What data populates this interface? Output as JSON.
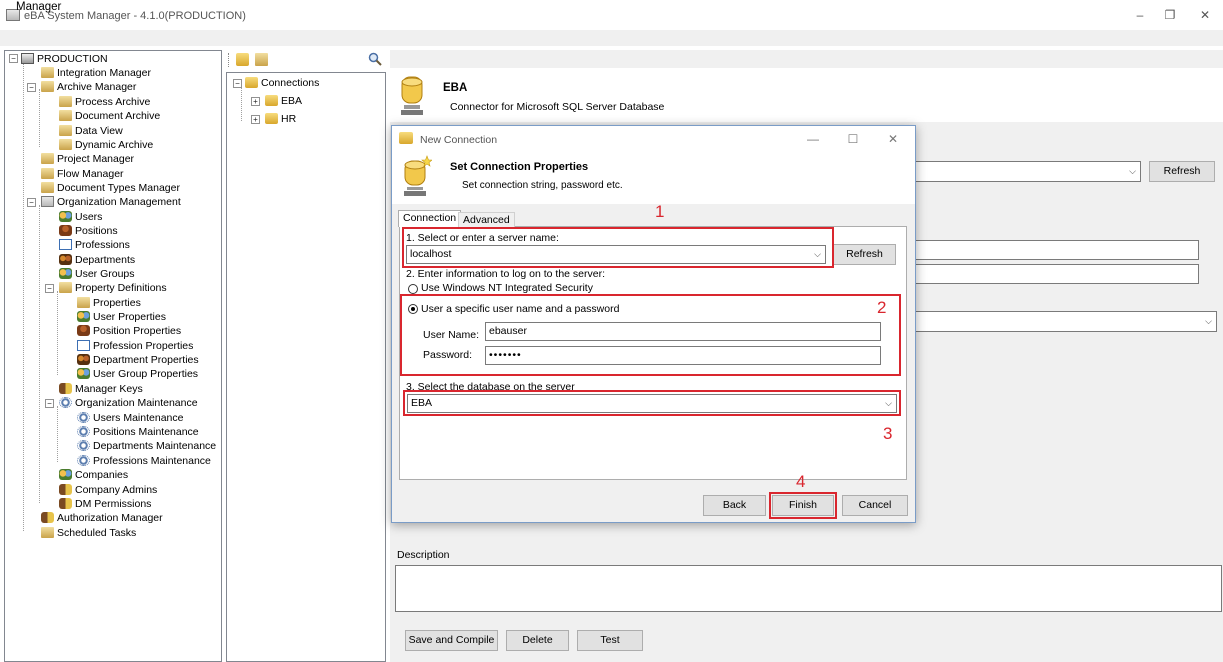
{
  "window": {
    "title": "eBA System Manager - 4.1.0(PRODUCTION)",
    "minimize": "–",
    "maximize": "❐",
    "close": "✕"
  },
  "menu": {
    "manager": "Manager"
  },
  "tree": {
    "root": "PRODUCTION",
    "items": [
      "Integration Manager",
      "Archive Manager",
      "Process Archive",
      "Document Archive",
      "Data View",
      "Dynamic Archive",
      "Project Manager",
      "Flow Manager",
      "Document Types Manager",
      "Organization Management",
      "Users",
      "Positions",
      "Professions",
      "Departments",
      "User Groups",
      "Property Definitions",
      "Properties",
      "User Properties",
      "Position Properties",
      "Profession Properties",
      "Department Properties",
      "User Group Properties",
      "Manager Keys",
      "Organization Maintenance",
      "Users Maintenance",
      "Positions Maintenance",
      "Departments Maintenance",
      "Professions Maintenance",
      "Companies",
      "Company Admins",
      "DM Permissions",
      "Authorization Manager",
      "Scheduled Tasks"
    ]
  },
  "connections": {
    "root": "Connections",
    "items": [
      "EBA",
      "HR"
    ]
  },
  "header": {
    "title": "EBA",
    "subtitle": "Connector for Microsoft SQL Server Database"
  },
  "right": {
    "refresh": "Refresh",
    "description_label": "Description",
    "buttons": {
      "save": "Save and Compile",
      "delete": "Delete",
      "test": "Test"
    }
  },
  "dialog": {
    "title": "New Connection",
    "head_title": "Set Connection Properties",
    "head_sub": "Set connection string, password etc.",
    "tabs": {
      "connection": "Connection",
      "advanced": "Advanced"
    },
    "step1_label": "1. Select or enter a server name:",
    "server_value": "localhost",
    "refresh": "Refresh",
    "step2_label": "2. Enter information to log on to the server:",
    "radio_windows": "Use Windows NT Integrated Security",
    "radio_specific": "User a specific user name and a password",
    "username_label": "User Name:",
    "username_value": "ebauser",
    "password_label": "Password:",
    "password_value": "•••••••",
    "step3_label": "3. Select the database on the server",
    "database_value": "EBA",
    "buttons": {
      "back": "Back",
      "finish": "Finish",
      "cancel": "Cancel"
    },
    "minimize": "—",
    "maximize": "☐",
    "close": "✕"
  },
  "annotations": {
    "n1": "1",
    "n2": "2",
    "n3": "3",
    "n4": "4"
  },
  "colors": {
    "annotation_red": "#d9262e",
    "tree_border": "#828790"
  }
}
